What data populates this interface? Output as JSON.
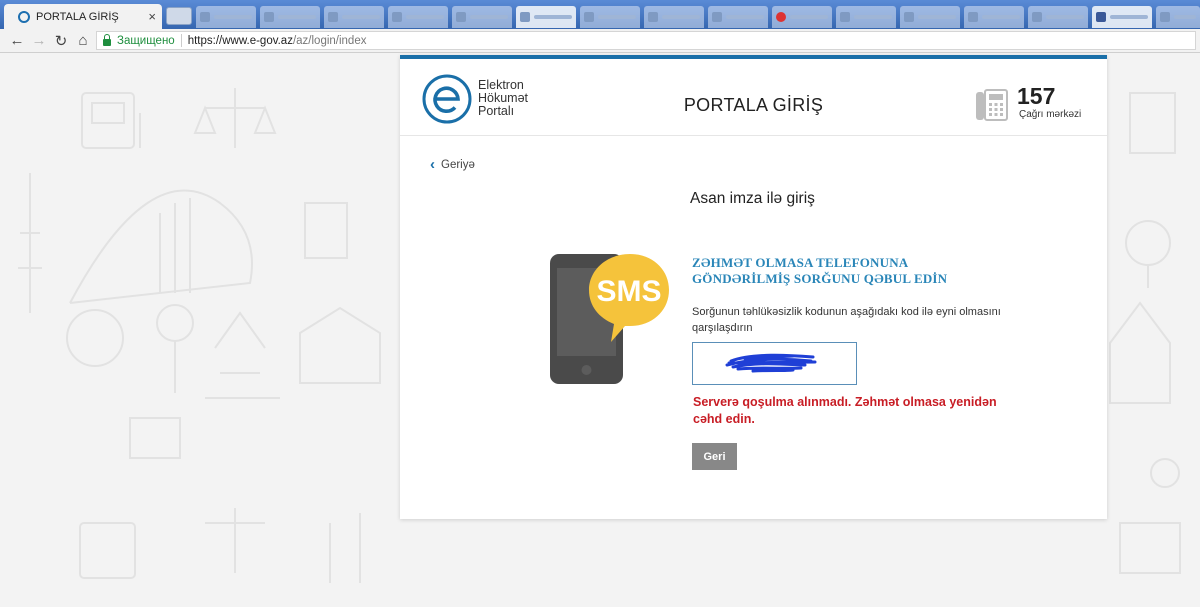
{
  "browser": {
    "active_tab": {
      "title": "PORTALA GİRİŞ",
      "close": "×"
    },
    "toolbar": {
      "back": "←",
      "forward": "→",
      "reload": "↻",
      "home": "⌂"
    },
    "address_bar": {
      "secure_label": "Защищено",
      "url_main": "https://www.e-gov.az",
      "url_path": "/az/login/index"
    }
  },
  "header": {
    "logo_lines": [
      "Elektron",
      "Hökumət",
      "Portalı"
    ],
    "title": "PORTALA GİRİŞ",
    "hotline_number": "157",
    "hotline_label": "Çağrı mərkəzi"
  },
  "content": {
    "back_label": "Geriyə",
    "section_title": "Asan imza ilə giriş",
    "sms_label": "SMS",
    "instruction_heading": "ZƏHMƏT OLMASA TELEFONUNA GÖNDƏRİLMİŞ SORĞUNU QƏBUL EDİN",
    "instruction_text": "Sorğunun təhlükəsizlik kodunun aşağıdakı kod ilə eyni olmasını qarşılaşdırın",
    "error_text": "Serverə qoşulma alınmadı. Zəhmət olmasa yenidən cəhd edin.",
    "button_label": "Geri"
  },
  "colors": {
    "brand_blue": "#1a6fa8",
    "heading_blue": "#2a86b8",
    "error_red": "#c81d25",
    "sms_yellow": "#f5c33b",
    "phone_gray": "#4a4a4a",
    "button_gray": "#888888"
  }
}
